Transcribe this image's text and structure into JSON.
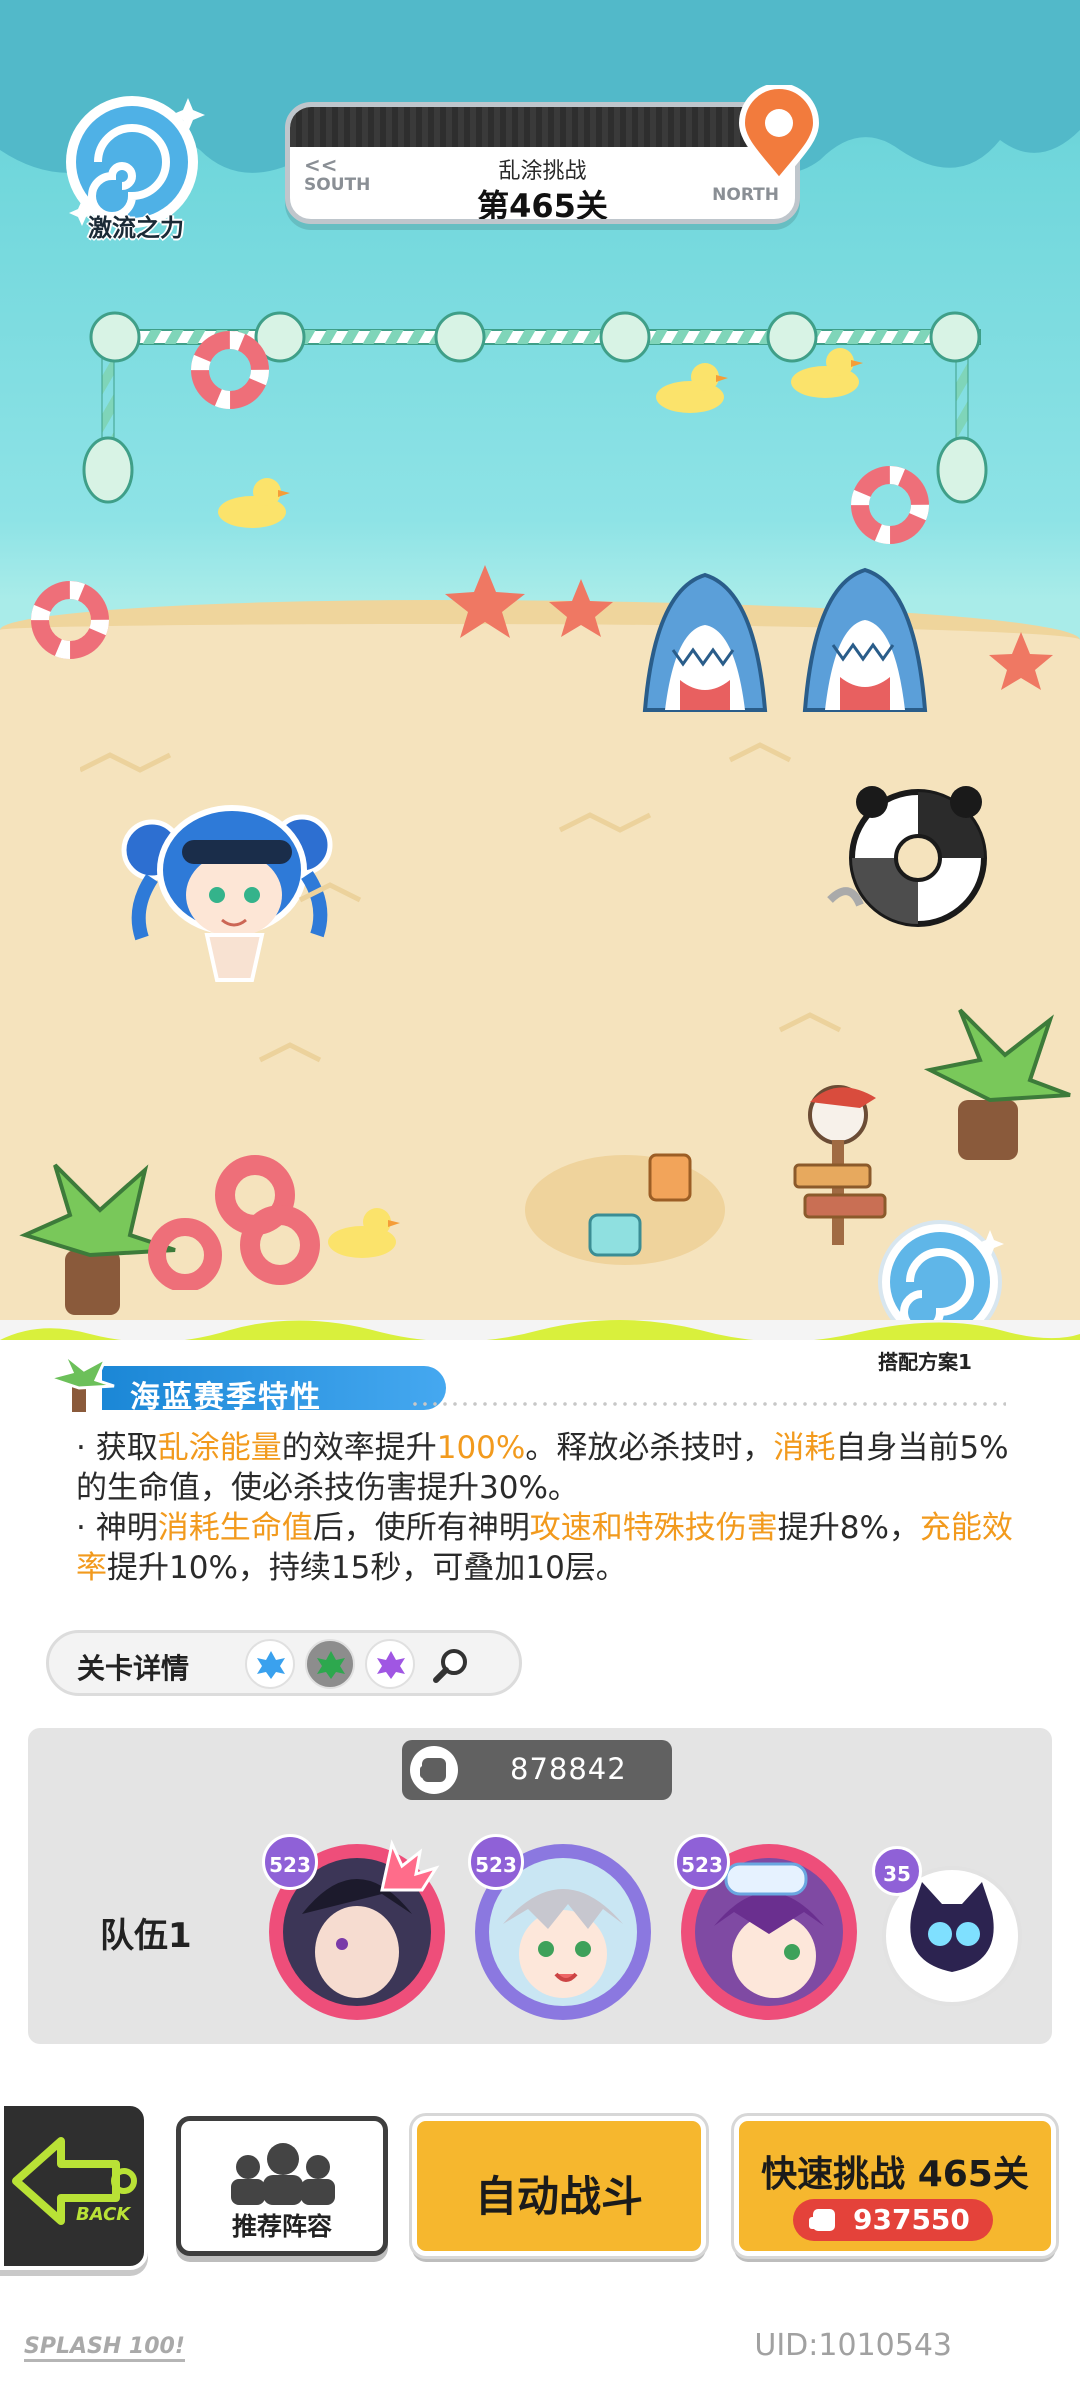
{
  "header": {
    "power_label": "激流之力",
    "stage_subtitle": "乱涂挑战",
    "stage_title": "第465关",
    "south_arrows": "<<",
    "south_label": "SOUTH",
    "north_label": "NORTH"
  },
  "season": {
    "title": "海蓝赛季特性",
    "line1": {
      "a": "· 获取",
      "b": "乱涂能量",
      "c": "的效率提升",
      "d": "100%",
      "e": "。释放必杀技时，",
      "f": "消耗",
      "g": "自身当前5%的生命值，使必杀技伤害提升30%。"
    },
    "line2": {
      "a": "· 神明",
      "b": "消耗生命值",
      "c": "后，使所有神明",
      "d": "攻速和特殊技伤害",
      "e": "提升8%，",
      "f": "充能效率",
      "g": "提升10%，持续15秒，可叠加10层。"
    }
  },
  "level_detail": {
    "label": "关卡详情"
  },
  "team": {
    "label": "队伍1",
    "power": "878842",
    "set_label": "搭配方案1",
    "members": [
      {
        "level": "523",
        "name": "hero-dark-hair",
        "color": "#ee4e7a"
      },
      {
        "level": "523",
        "name": "hero-silver-hair",
        "color": "#8b78e0"
      },
      {
        "level": "523",
        "name": "hero-purple-hair",
        "color": "#ee4e7a"
      },
      {
        "level": "35",
        "name": "pet-black-cat",
        "color": "#8f61d7"
      }
    ]
  },
  "buttons": {
    "back": "BACK",
    "recommend": "推荐阵容",
    "auto": "自动战斗",
    "quick": "快速挑战 465关",
    "quick_cost": "937550"
  },
  "footer": {
    "logo": "SPLASH 100!",
    "uid": "UID:1010543"
  },
  "colors": {
    "accent_orange": "#f29a1d",
    "button_yellow": "#f6b72e",
    "season_blue": "#1b87d6",
    "slime_green": "#d9f03c"
  }
}
